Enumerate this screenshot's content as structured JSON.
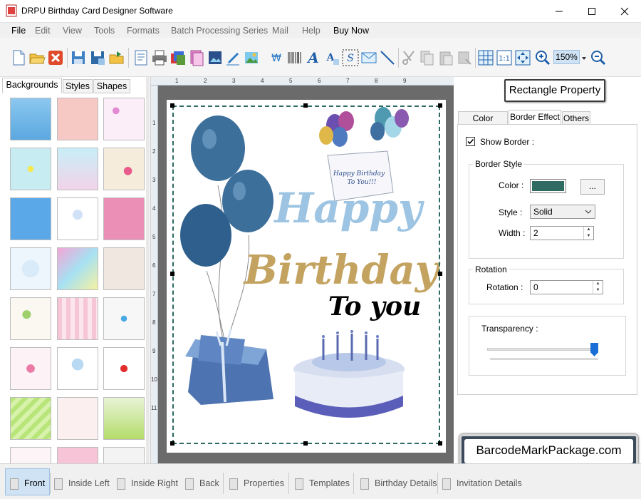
{
  "window": {
    "title": "DRPU Birthday Card Designer Software"
  },
  "menu": {
    "items": [
      "File",
      "Edit",
      "View",
      "Tools",
      "Formats",
      "Batch Processing Series",
      "Mail",
      "Help",
      "Buy Now"
    ]
  },
  "toolbar": {
    "zoom": "150%"
  },
  "left_panel": {
    "tabs": [
      "Backgrounds",
      "Styles",
      "Shapes"
    ],
    "selected_tab": "Backgrounds"
  },
  "ruler": {
    "h_numbers": [
      "1",
      "2",
      "3",
      "4",
      "5",
      "6",
      "7",
      "8",
      "9"
    ],
    "v_numbers": [
      "1",
      "2",
      "3",
      "4",
      "5",
      "6",
      "7",
      "8",
      "9",
      "10",
      "11"
    ]
  },
  "card": {
    "line1": "Happy",
    "line2": "Birthday",
    "line3": "To you",
    "sign_line1": "Happy Birthday",
    "sign_line2": "To You!!!"
  },
  "right_panel": {
    "header": "Rectangle Property",
    "tabs": [
      "Color Effects",
      "Border Effect",
      "Others"
    ],
    "selected_tab": "Border Effect",
    "show_border_label": "Show Border :",
    "show_border_checked": true,
    "border_style_group": "Border Style",
    "color_label": "Color :",
    "color_value": "#2f6b63",
    "browse_label": "...",
    "style_label": "Style :",
    "style_value": "Solid",
    "width_label": "Width :",
    "width_value": "2",
    "rotation_group": "Rotation",
    "rotation_label": "Rotation :",
    "rotation_value": "0",
    "transparency_label": "Transparency :",
    "transparency_level": 1.0
  },
  "watermark": "BarcodeMarkPackage.com",
  "bottom_tabs": [
    "Front",
    "Inside Left",
    "Inside Right",
    "Back",
    "Properties",
    "Templates",
    "Birthday Details",
    "Invitation Details"
  ],
  "bottom_selected": "Front"
}
